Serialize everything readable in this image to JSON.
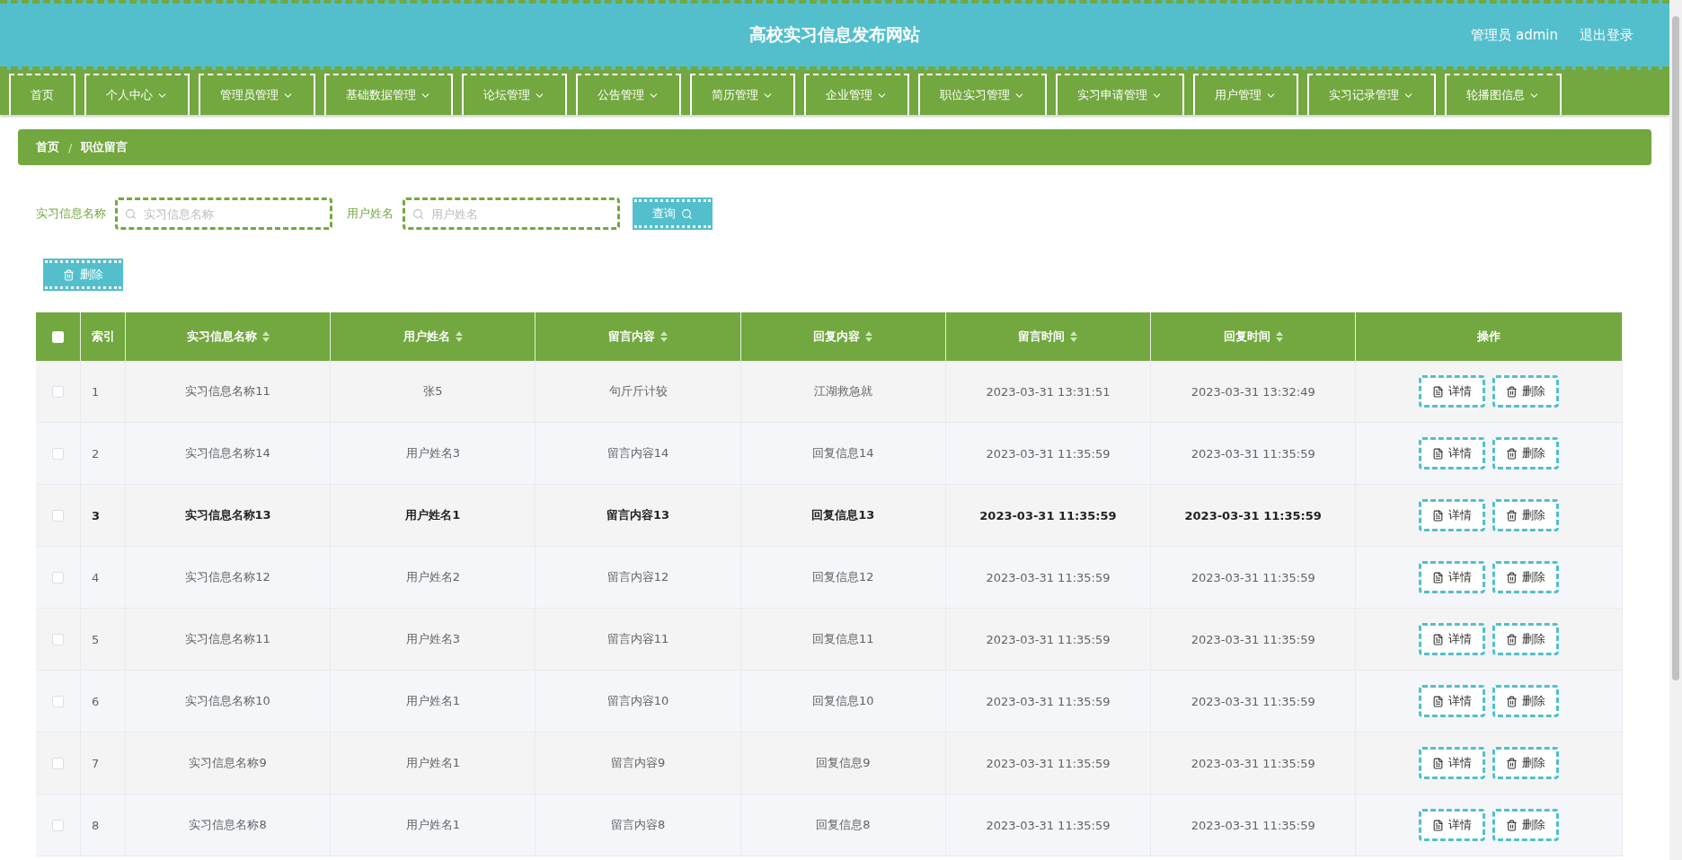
{
  "header": {
    "title": "高校实习信息发布网站",
    "user": "管理员 admin",
    "logout": "退出登录"
  },
  "nav": [
    {
      "label": "首页",
      "dropdown": false
    },
    {
      "label": "个人中心",
      "dropdown": true
    },
    {
      "label": "管理员管理",
      "dropdown": true
    },
    {
      "label": "基础数据管理",
      "dropdown": true
    },
    {
      "label": "论坛管理",
      "dropdown": true
    },
    {
      "label": "公告管理",
      "dropdown": true
    },
    {
      "label": "简历管理",
      "dropdown": true
    },
    {
      "label": "企业管理",
      "dropdown": true
    },
    {
      "label": "职位实习管理",
      "dropdown": true
    },
    {
      "label": "实习申请管理",
      "dropdown": true
    },
    {
      "label": "用户管理",
      "dropdown": true
    },
    {
      "label": "实习记录管理",
      "dropdown": true
    },
    {
      "label": "轮播图信息",
      "dropdown": true
    }
  ],
  "breadcrumb": [
    "首页",
    "职位留言"
  ],
  "breadcrumb_separator": "/",
  "search": {
    "fields": [
      {
        "label": "实习信息名称",
        "placeholder": "实习信息名称"
      },
      {
        "label": "用户姓名",
        "placeholder": "用户姓名"
      }
    ],
    "button": "查询"
  },
  "delete_button": "删除",
  "table": {
    "select_all": {
      "checked": false
    },
    "columns": [
      {
        "label": "索引",
        "sortable": false
      },
      {
        "label": "实习信息名称",
        "sortable": true
      },
      {
        "label": "用户姓名",
        "sortable": true
      },
      {
        "label": "留言内容",
        "sortable": true
      },
      {
        "label": "回复内容",
        "sortable": true
      },
      {
        "label": "留言时间",
        "sortable": true
      },
      {
        "label": "回复时间",
        "sortable": true
      },
      {
        "label": "操作",
        "sortable": false
      }
    ],
    "rows": [
      {
        "checked": false,
        "highlighted": false,
        "cells": [
          "1",
          "实习信息名称11",
          "张5",
          "句斤斤计较",
          "江湖救急就",
          "2023-03-31 13:31:51",
          "2023-03-31 13:32:49"
        ]
      },
      {
        "checked": false,
        "highlighted": false,
        "cells": [
          "2",
          "实习信息名称14",
          "用户姓名3",
          "留言内容14",
          "回复信息14",
          "2023-03-31 11:35:59",
          "2023-03-31 11:35:59"
        ]
      },
      {
        "checked": false,
        "highlighted": true,
        "cells": [
          "3",
          "实习信息名称13",
          "用户姓名1",
          "留言内容13",
          "回复信息13",
          "2023-03-31 11:35:59",
          "2023-03-31 11:35:59"
        ]
      },
      {
        "checked": false,
        "highlighted": false,
        "cells": [
          "4",
          "实习信息名称12",
          "用户姓名2",
          "留言内容12",
          "回复信息12",
          "2023-03-31 11:35:59",
          "2023-03-31 11:35:59"
        ]
      },
      {
        "checked": false,
        "highlighted": false,
        "cells": [
          "5",
          "实习信息名称11",
          "用户姓名3",
          "留言内容11",
          "回复信息11",
          "2023-03-31 11:35:59",
          "2023-03-31 11:35:59"
        ]
      },
      {
        "checked": false,
        "highlighted": false,
        "cells": [
          "6",
          "实习信息名称10",
          "用户姓名1",
          "留言内容10",
          "回复信息10",
          "2023-03-31 11:35:59",
          "2023-03-31 11:35:59"
        ]
      },
      {
        "checked": false,
        "highlighted": false,
        "cells": [
          "7",
          "实习信息名称9",
          "用户姓名1",
          "留言内容9",
          "回复信息9",
          "2023-03-31 11:35:59",
          "2023-03-31 11:35:59"
        ]
      },
      {
        "checked": false,
        "highlighted": false,
        "cells": [
          "8",
          "实习信息名称8",
          "用户姓名1",
          "留言内容8",
          "回复信息8",
          "2023-03-31 11:35:59",
          "2023-03-31 11:35:59"
        ]
      }
    ],
    "row_actions": [
      [
        "详情",
        "删除"
      ],
      [
        "详情",
        "删除"
      ],
      [
        "详情",
        "删除"
      ],
      [
        "详情",
        "删除"
      ],
      [
        "详情",
        "删除"
      ],
      [
        "详情",
        "删除"
      ],
      [
        "详情",
        "删除"
      ],
      [
        "详情",
        "删除"
      ]
    ]
  }
}
